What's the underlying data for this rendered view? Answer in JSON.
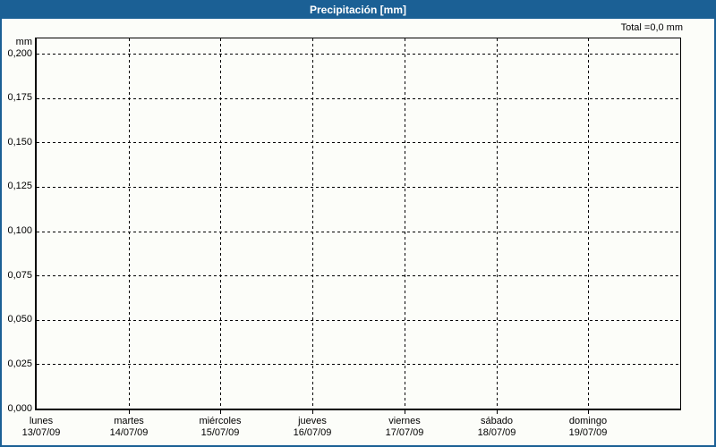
{
  "window": {
    "title": "Precipitación [mm]"
  },
  "summary": {
    "total_label": "Total =0,0 mm"
  },
  "chart_data": {
    "type": "bar",
    "title": "Precipitación [mm]",
    "y_unit_label": "mm",
    "total_text": "Total =0,0 mm",
    "total_value_mm": 0.0,
    "x_categories": [
      {
        "day": "lunes",
        "date": "13/07/09"
      },
      {
        "day": "martes",
        "date": "14/07/09"
      },
      {
        "day": "miércoles",
        "date": "15/07/09"
      },
      {
        "day": "jueves",
        "date": "16/07/09"
      },
      {
        "day": "viernes",
        "date": "17/07/09"
      },
      {
        "day": "sábado",
        "date": "18/07/09"
      },
      {
        "day": "domingo",
        "date": "19/07/09"
      }
    ],
    "series": [
      {
        "name": "Precipitación",
        "values": [
          0,
          0,
          0,
          0,
          0,
          0,
          0
        ]
      }
    ],
    "y_ticks": [
      "0,200",
      "0,175",
      "0,150",
      "0,125",
      "0,100",
      "0,075",
      "0,050",
      "0,025",
      "0,000"
    ],
    "ylim": [
      0,
      0.21
    ],
    "grid": "dashed",
    "legend": "none",
    "colors": {
      "titlebar_bg": "#1b6095",
      "titlebar_text": "#ffffff",
      "frame_border": "#1b6095",
      "background": "#fcfdf9",
      "grid_color": "#000000",
      "text_color": "#000000"
    }
  }
}
